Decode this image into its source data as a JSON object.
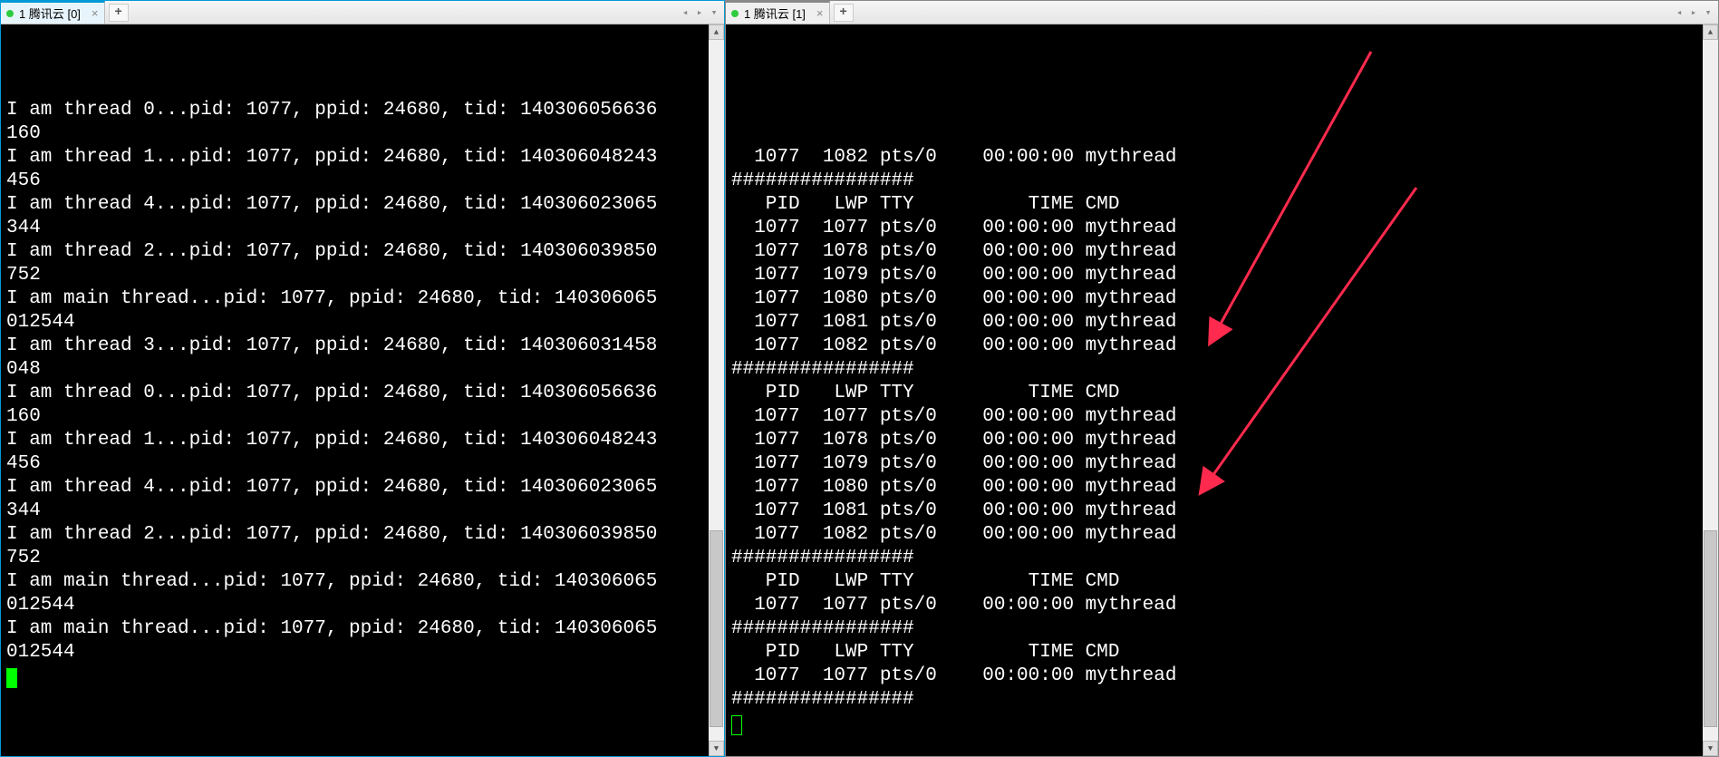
{
  "tabs": {
    "left": {
      "label": "1 腾讯云 [0]"
    },
    "right": {
      "label": "1 腾讯云 [1]"
    }
  },
  "left_terminal_lines": [
    "I am thread 0...pid: 1077, ppid: 24680, tid: 140306056636",
    "160",
    "I am thread 1...pid: 1077, ppid: 24680, tid: 140306048243",
    "456",
    "I am thread 4...pid: 1077, ppid: 24680, tid: 140306023065",
    "344",
    "I am thread 2...pid: 1077, ppid: 24680, tid: 140306039850",
    "752",
    "I am main thread...pid: 1077, ppid: 24680, tid: 140306065",
    "012544",
    "I am thread 3...pid: 1077, ppid: 24680, tid: 140306031458",
    "048",
    "I am thread 0...pid: 1077, ppid: 24680, tid: 140306056636",
    "160",
    "I am thread 1...pid: 1077, ppid: 24680, tid: 140306048243",
    "456",
    "I am thread 4...pid: 1077, ppid: 24680, tid: 140306023065",
    "344",
    "I am thread 2...pid: 1077, ppid: 24680, tid: 140306039850",
    "752",
    "I am main thread...pid: 1077, ppid: 24680, tid: 140306065",
    "012544",
    "I am main thread...pid: 1077, ppid: 24680, tid: 140306065",
    "012544"
  ],
  "right_terminal_lines": [
    "  1077  1082 pts/0    00:00:00 mythread",
    "################",
    "   PID   LWP TTY          TIME CMD",
    "  1077  1077 pts/0    00:00:00 mythread",
    "  1077  1078 pts/0    00:00:00 mythread",
    "  1077  1079 pts/0    00:00:00 mythread",
    "  1077  1080 pts/0    00:00:00 mythread",
    "  1077  1081 pts/0    00:00:00 mythread",
    "  1077  1082 pts/0    00:00:00 mythread",
    "################",
    "   PID   LWP TTY          TIME CMD",
    "  1077  1077 pts/0    00:00:00 mythread",
    "  1077  1078 pts/0    00:00:00 mythread",
    "  1077  1079 pts/0    00:00:00 mythread",
    "  1077  1080 pts/0    00:00:00 mythread",
    "  1077  1081 pts/0    00:00:00 mythread",
    "  1077  1082 pts/0    00:00:00 mythread",
    "################",
    "   PID   LWP TTY          TIME CMD",
    "  1077  1077 pts/0    00:00:00 mythread",
    "################",
    "   PID   LWP TTY          TIME CMD",
    "  1077  1077 pts/0    00:00:00 mythread",
    "################"
  ],
  "annotations": {
    "arrow_color": "#ff2a4d"
  }
}
